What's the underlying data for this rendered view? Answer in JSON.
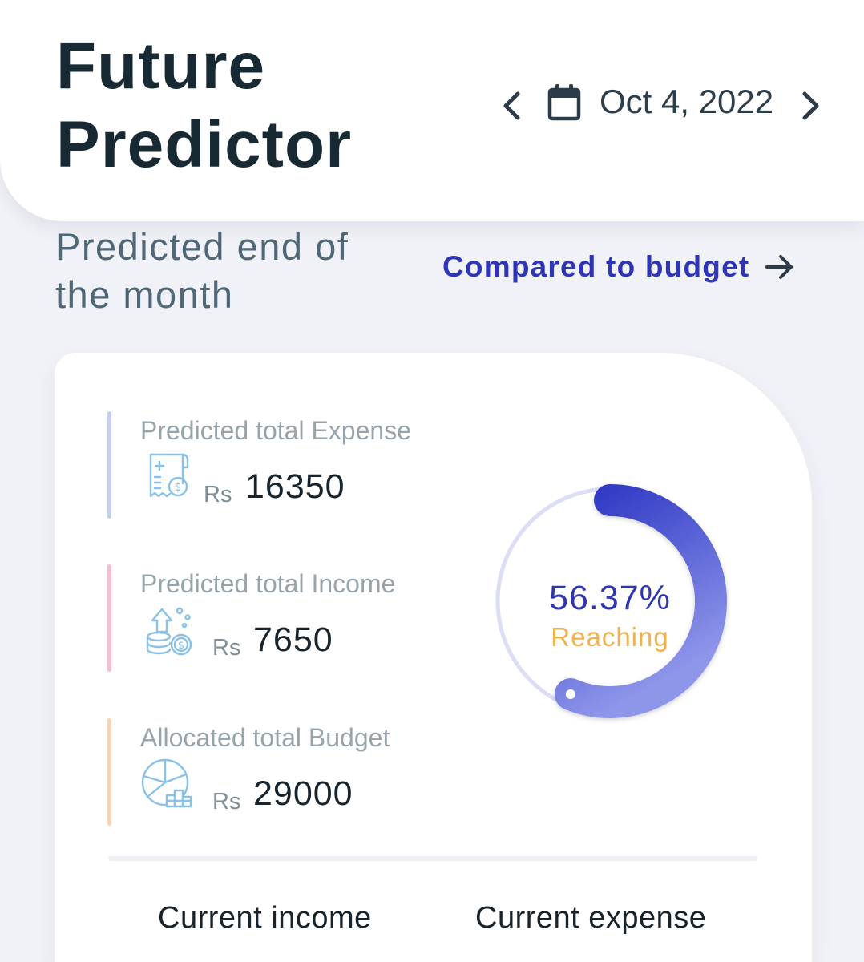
{
  "header": {
    "title_line1": "Future",
    "title_line2": "Predictor",
    "date": "Oct 4, 2022",
    "icons": {
      "prev": "chevron-left-icon",
      "calendar": "calendar-icon",
      "next": "chevron-right-icon"
    }
  },
  "section": {
    "title_line1": "Predicted end of",
    "title_line2": "the month",
    "compare_link": "Compared to budget",
    "compare_icon": "arrow-right-icon"
  },
  "stats": [
    {
      "label": "Predicted total Expense",
      "currency": "Rs",
      "value": "16350",
      "bar_color": "#c6d0ec",
      "icon": "receipt-dollar-icon"
    },
    {
      "label": "Predicted total Income",
      "currency": "Rs",
      "value": "7650",
      "bar_color": "#f2bfcf",
      "icon": "coins-growth-icon"
    },
    {
      "label": "Allocated total Budget",
      "currency": "Rs",
      "value": "29000",
      "bar_color": "#f6d3b6",
      "icon": "pie-chart-coins-icon"
    }
  ],
  "progress": {
    "percent_text": "56.37%",
    "percent_value": 56.37,
    "caption": "Reaching",
    "colors": {
      "track": "#dcdef5",
      "arc_start": "#2e37c4",
      "arc_end": "#8e96ea",
      "percent_text": "#2f36b0",
      "caption": "#f0b24f"
    }
  },
  "bottom": {
    "income_label": "Current income",
    "expense_label": "Current expense"
  },
  "colors": {
    "page_background": "#f1f2f7",
    "card_background": "#ffffff",
    "title": "#172a33",
    "link": "#2f36b6",
    "icon_line": "#89c2e9"
  }
}
